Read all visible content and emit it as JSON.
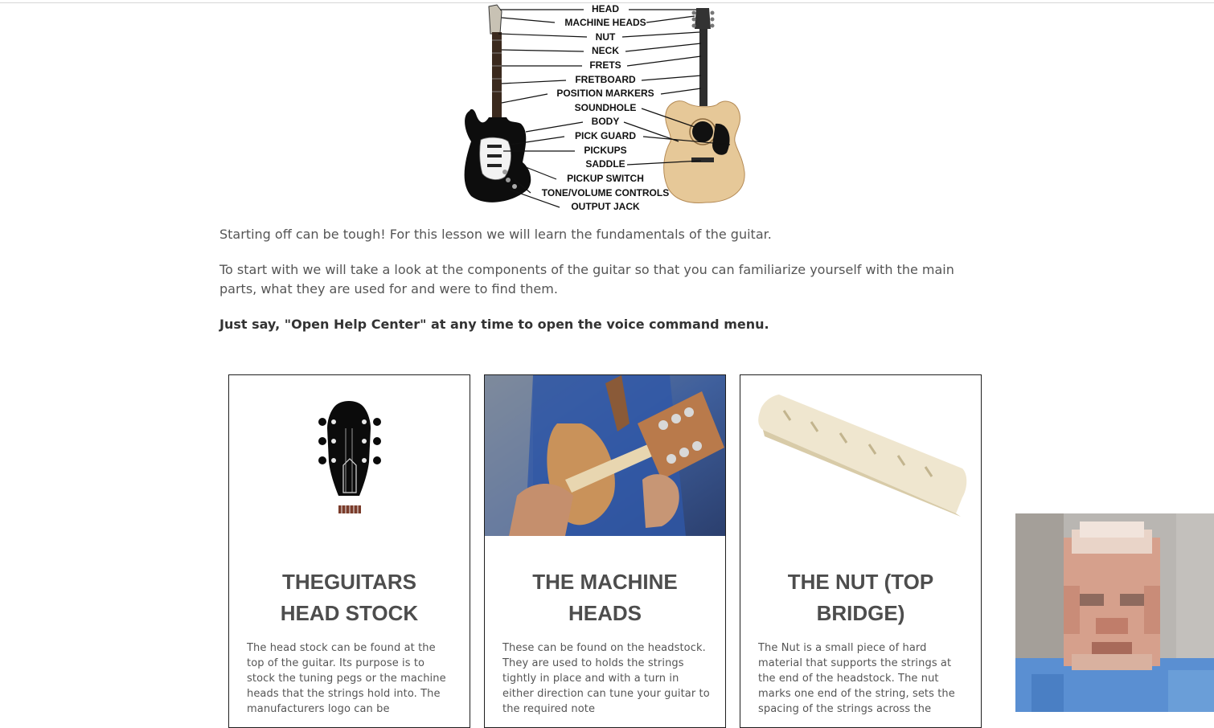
{
  "diagram": {
    "labels": [
      "HEAD",
      "MACHINE HEADS",
      "NUT",
      "NECK",
      "FRETS",
      "FRETBOARD",
      "POSITION MARKERS",
      "SOUNDHOLE",
      "BODY",
      "PICK GUARD",
      "PICKUPS",
      "SADDLE",
      "PICKUP SWITCH",
      "TONE/VOLUME CONTROLS",
      "OUTPUT JACK"
    ]
  },
  "intro": {
    "p1": "Starting off can be tough! For this lesson we will learn the fundamentals of the guitar.",
    "p2": "To start with we will take a look at the components of the guitar so that you can familiarize yourself with the main parts, what they are used for and were to find them.",
    "p3": "Just say, \"Open Help Center\" at any time to open the voice command menu."
  },
  "cards": [
    {
      "title_line1": "THEGUITARS",
      "title_line2": "HEAD STOCK",
      "text": "The head stock can be found at the top of the guitar. Its purpose is to stock the tuning pegs or the machine heads that the strings hold into. The manufacturers logo can be"
    },
    {
      "title_line1": "THE MACHINE",
      "title_line2": "HEADS",
      "text": "These can be found on the headstock. They are used to holds the strings tightly in place and with a turn in either direction can tune your guitar to the required note"
    },
    {
      "title_line1": "THE NUT (TOP",
      "title_line2": "BRIDGE)",
      "text": "The Nut is a small piece of hard material that supports the strings at the end of the headstock. The nut marks one end of the string, sets the spacing of the strings across the"
    }
  ]
}
